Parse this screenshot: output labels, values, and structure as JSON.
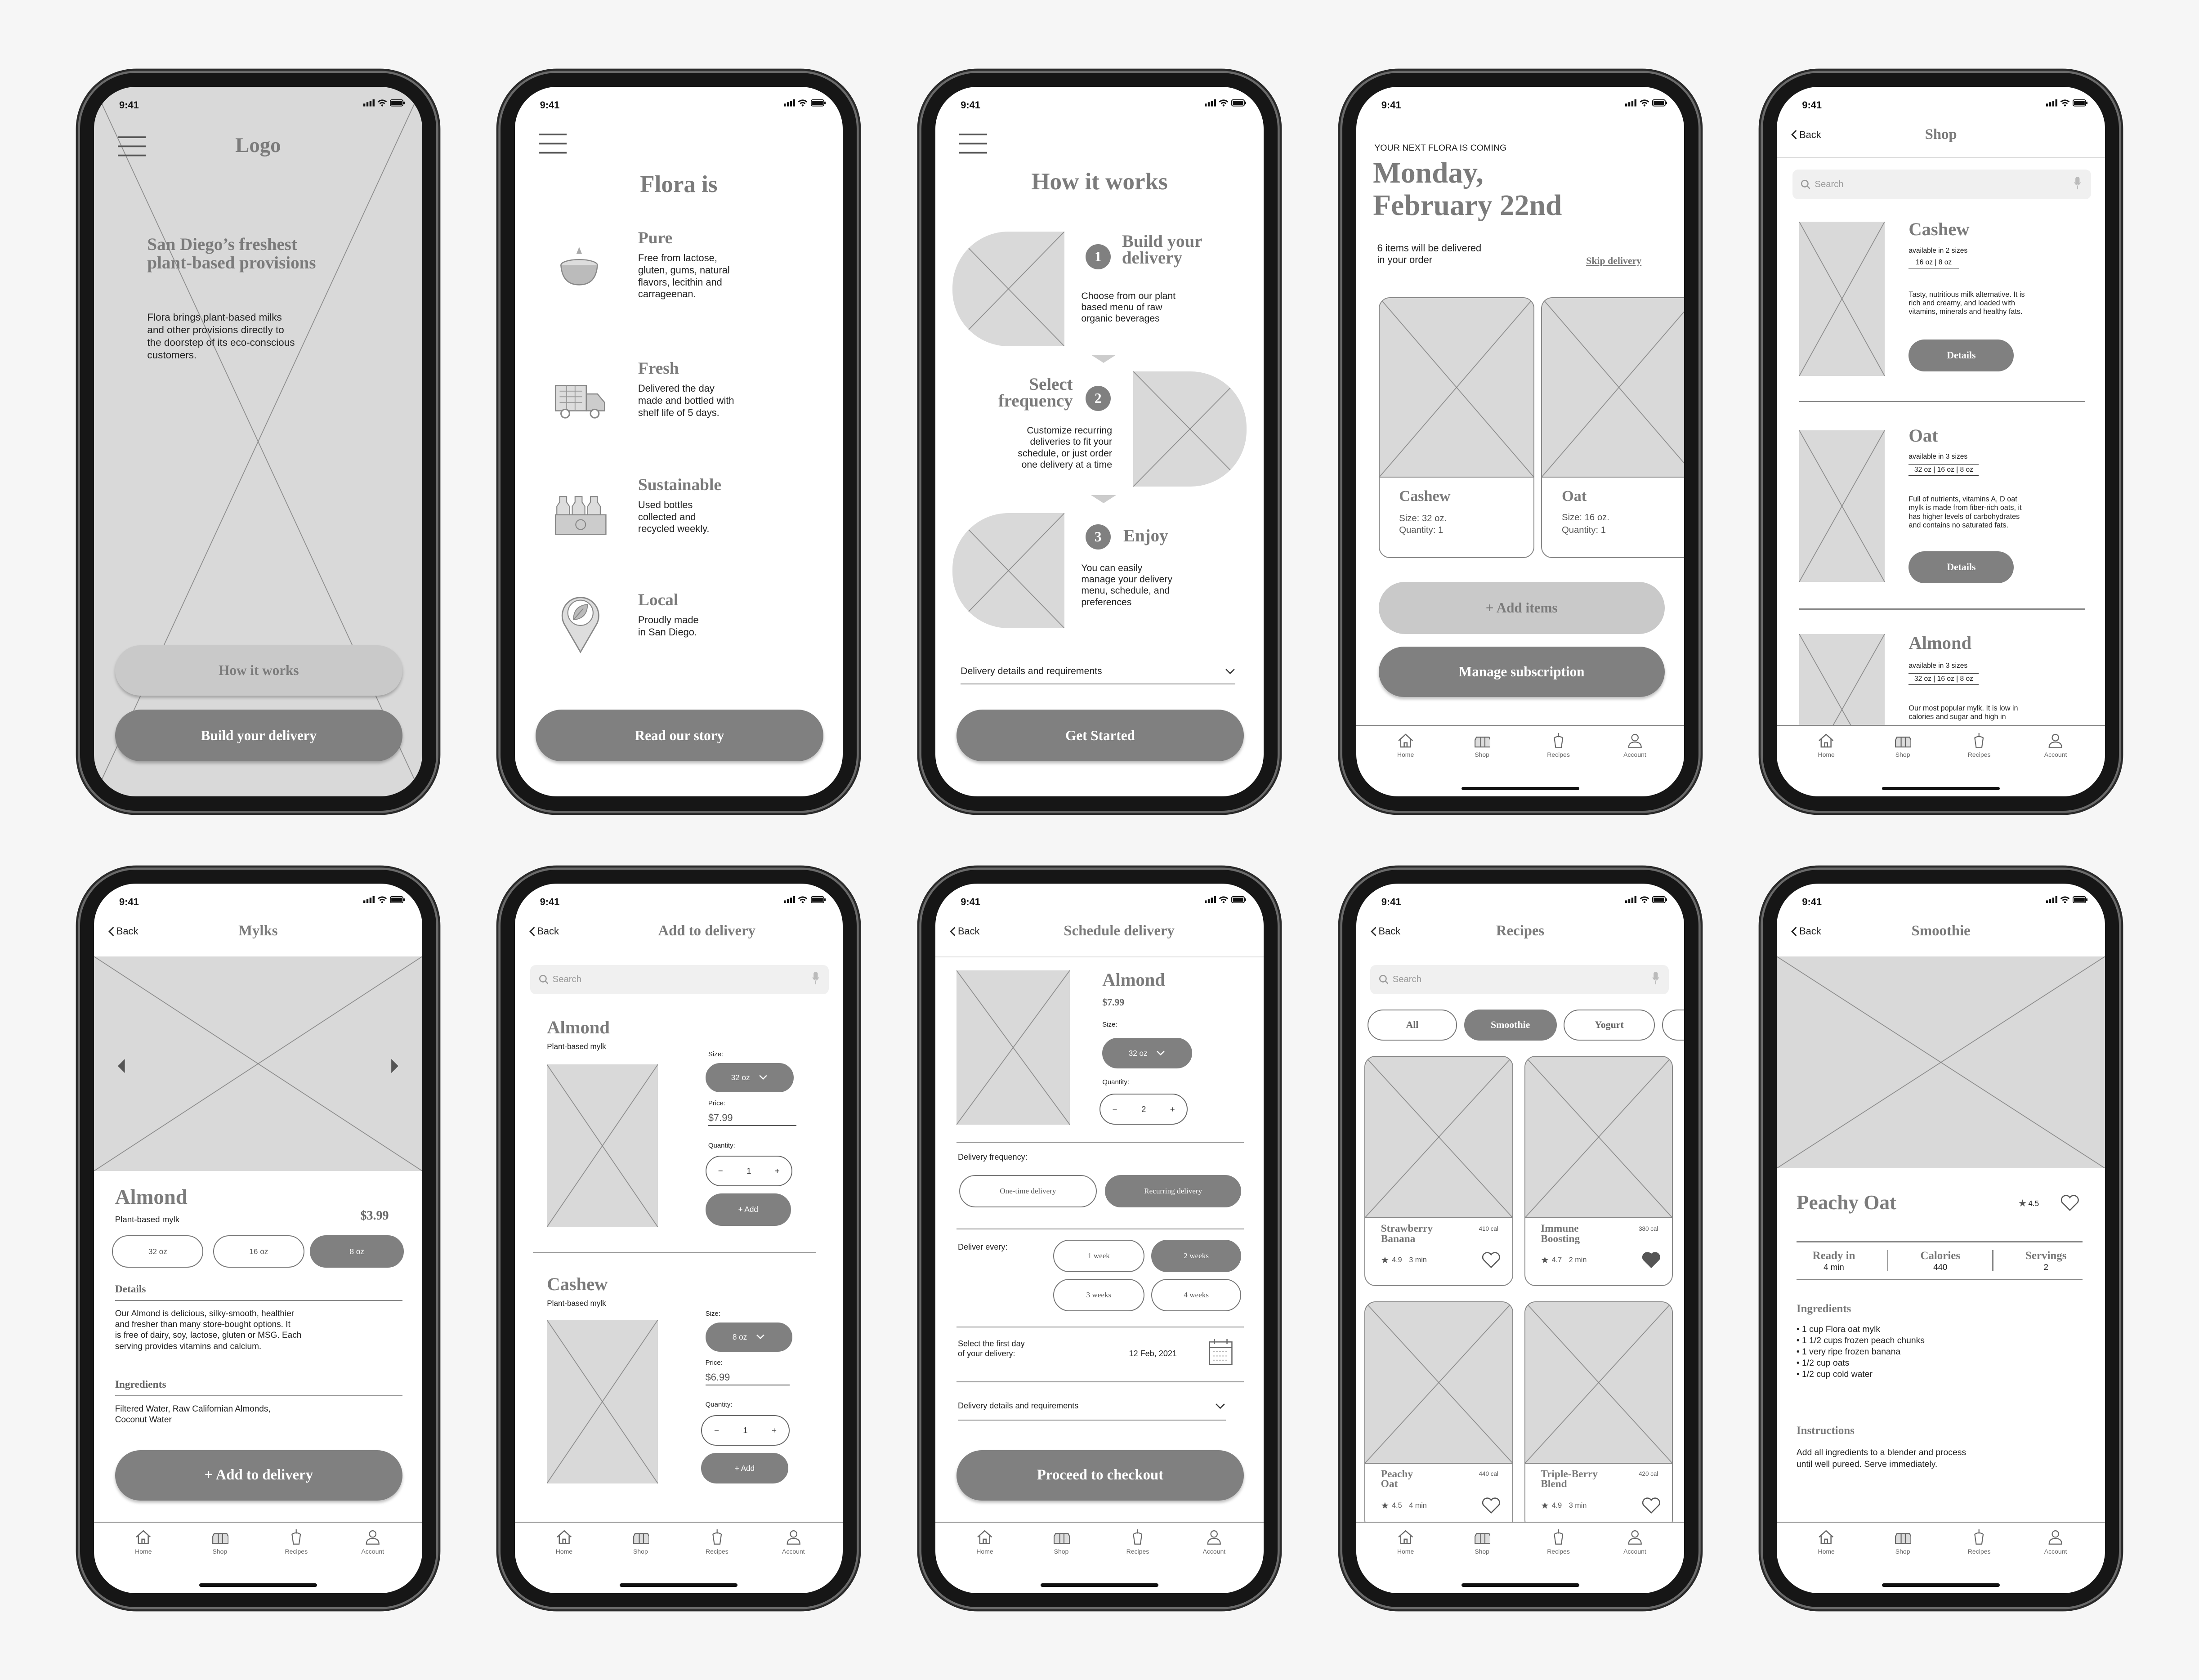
{
  "colors": {
    "button_dark": "#808080",
    "button_light": "#c9c9c9",
    "placeholder": "#d9d9d9",
    "heading": "#7b7b7b",
    "background": "#f6f6f6"
  },
  "status_time": "9:41",
  "back": "Back",
  "tabbar": {
    "home": "Home",
    "shop": "Shop",
    "recipes": "Recipes",
    "account": "Account"
  },
  "s1": {
    "logo": "Logo",
    "headline": "San Diego’s freshest\nplant-based provisions",
    "body": "Flora brings plant-based milks\nand other provisions directly to\nthe doorstep of its eco-conscious\ncustomers.",
    "how": "How it works",
    "build": "Build your delivery"
  },
  "s2": {
    "title": "Flora is",
    "items": [
      {
        "title": "Pure",
        "desc": "Free from lactose,\ngluten, gums, natural\nflavors, lecithin and\ncarrageenan.",
        "icon": "coconut-icon"
      },
      {
        "title": "Fresh",
        "desc": "Delivered the day\nmade and bottled with\nshelf life of 5 days.",
        "icon": "truck-icon"
      },
      {
        "title": "Sustainable",
        "desc": "Used bottles\ncollected and\nrecycled weekly.",
        "icon": "bottle-crate-icon"
      },
      {
        "title": "Local",
        "desc": "Proudly made\nin San Diego.",
        "icon": "location-leaf-icon"
      }
    ],
    "cta": "Read our story"
  },
  "s3": {
    "title": "How it works",
    "steps": [
      {
        "n": "1",
        "title": "Build your\ndelivery",
        "desc": "Choose from our plant\nbased menu of raw\norganic beverages"
      },
      {
        "n": "2",
        "title": "Select\nfrequency",
        "desc": "Customize recurring\ndeliveries to fit your\nschedule, or just order\none delivery at a time"
      },
      {
        "n": "3",
        "title": "Enjoy",
        "desc": "You can easily\nmanage your delivery\nmenu, schedule, and\npreferences"
      }
    ],
    "dropdown": "Delivery details and requirements",
    "cta": "Get Started"
  },
  "s4": {
    "eyebrow": "YOUR NEXT FLORA IS COMING",
    "date": "Monday,\nFebruary 22nd",
    "count": "6 items will be delivered\nin your order",
    "skip": "Skip delivery",
    "items": [
      {
        "name": "Cashew",
        "size": "Size: 32 oz.",
        "qty": "Quantity: 1"
      },
      {
        "name": "Oat",
        "size": "Size: 16 oz.",
        "qty": "Quantity: 1"
      }
    ],
    "add": "+   Add items",
    "manage": "Manage subscription"
  },
  "s5": {
    "title": "Shop",
    "search": "Search",
    "details": "Details",
    "products": [
      {
        "name": "Cashew",
        "avail": "available in 2 sizes",
        "sizes": "16 oz   |   8 oz",
        "desc": "Tasty, nutritious milk alternative. It is\nrich and creamy, and loaded with\nvitamins, minerals and healthy fats."
      },
      {
        "name": "Oat",
        "avail": "available in 3 sizes",
        "sizes": "32 oz   |   16 oz   |   8 oz",
        "desc": "Full of nutrients, vitamins A, D oat\nmylk is made from fiber-rich oats, it\nhas higher levels of carbohydrates\nand contains no saturated fats."
      },
      {
        "name": "Almond",
        "avail": "available in 3 sizes",
        "sizes": "32 oz   |   16 oz   |   8 oz",
        "desc": "Our most popular mylk. It is low in\ncalories and sugar and high in"
      }
    ]
  },
  "s6": {
    "title": "Mylks",
    "name": "Almond",
    "sub": "Plant-based mylk",
    "price": "$3.99",
    "sizes": [
      "32 oz",
      "16 oz",
      "8 oz"
    ],
    "selected": "8 oz",
    "details_h": "Details",
    "details": "Our Almond is delicious, silky-smooth, healthier\nand fresher than many store-bought options. It\nis free of dairy, soy, lactose, gluten or MSG. Each\nserving provides vitamins and calcium.",
    "ingr_h": "Ingredients",
    "ingr": "Filtered Water, Raw Californian Almonds,\nCoconut Water",
    "cta": "+   Add to delivery"
  },
  "s7": {
    "title": "Add to delivery",
    "search": "Search",
    "size_l": "Size:",
    "price_l": "Price:",
    "qty_l": "Quantity:",
    "add": "+  Add",
    "items": [
      {
        "name": "Almond",
        "sub": "Plant-based mylk",
        "size": "32 oz",
        "price": "$7.99",
        "qty": "1"
      },
      {
        "name": "Cashew",
        "sub": "Plant-based mylk",
        "size": "8 oz",
        "price": "$6.99",
        "qty": "1"
      }
    ]
  },
  "s8": {
    "title": "Schedule delivery",
    "name": "Almond",
    "price": "$7.99",
    "size_l": "Size:",
    "size": "32 oz",
    "qty_l": "Quantity:",
    "qty": "2",
    "freq_l": "Delivery frequency:",
    "freq": [
      "One-time delivery",
      "Recurring delivery"
    ],
    "freq_selected": "Recurring delivery",
    "every_l": "Deliver every:",
    "every": [
      "1 week",
      "2 weeks",
      "3 weeks",
      "4 weeks"
    ],
    "every_selected": "2 weeks",
    "first_l": "Select the first day\nof your delivery:",
    "first": "12 Feb, 2021",
    "dropdown": "Delivery details and requirements",
    "cta": "Proceed to checkout"
  },
  "s9": {
    "title": "Recipes",
    "search": "Search",
    "chips": [
      "All",
      "Smoothie",
      "Yogurt"
    ],
    "chip_selected": "Smoothie",
    "recipes": [
      {
        "name": "Strawberry\nBanana",
        "cal": "410 cal",
        "rating": "4.9",
        "time": "3 min",
        "fav": false
      },
      {
        "name": "Immune\nBoosting",
        "cal": "380 cal",
        "rating": "4.7",
        "time": "2 min",
        "fav": true
      },
      {
        "name": "Peachy\nOat",
        "cal": "440 cal",
        "rating": "4.5",
        "time": "4 min",
        "fav": false
      },
      {
        "name": "Triple-Berry\nBlend",
        "cal": "420 cal",
        "rating": "4.9",
        "time": "3 min",
        "fav": false
      }
    ]
  },
  "s10": {
    "title": "Smoothie",
    "name": "Peachy Oat",
    "rating": "4.5",
    "stats": [
      {
        "l": "Ready in",
        "v": "4 min"
      },
      {
        "l": "Calories",
        "v": "440"
      },
      {
        "l": "Servings",
        "v": "2"
      }
    ],
    "ingr_h": "Ingredients",
    "ingr": "• 1 cup Flora oat mylk\n• 1 1/2 cups frozen peach chunks\n• 1 very ripe frozen banana\n• 1/2 cup oats\n• 1/2 cup cold water",
    "instr_h": "Instructions",
    "instr": "Add all ingredients to a blender and process\nuntil well pureed. Serve immediately."
  }
}
